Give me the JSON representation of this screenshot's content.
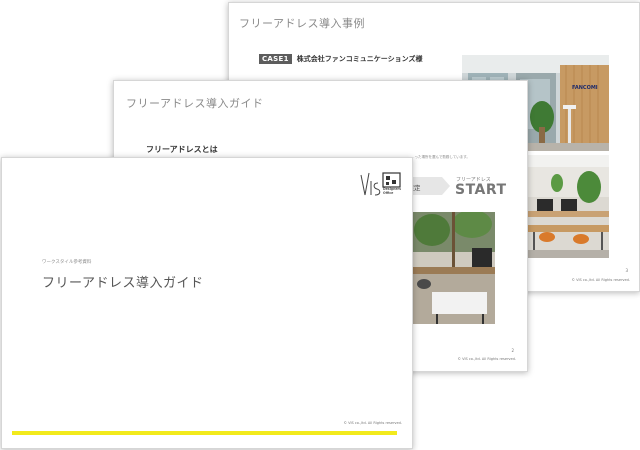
{
  "slides": {
    "case": {
      "title": "フリーアドレス導入事例",
      "case_tag": "CASE1",
      "company": "株式会社ファンコミュニケーションズ様",
      "sign_text": "FANCOMI",
      "page_number": "3",
      "footer": "© VIS co.,ltd. All Rights reserved."
    },
    "guide": {
      "title": "フリーアドレス導入ガイド",
      "section_heading": "フリーアドレスとは",
      "body_text": "…った場所を選んで勤務しています。",
      "step_label": "の策定",
      "start_small": "フリーアドレス",
      "start_big": "START",
      "page_number": "2",
      "footer": "© VIS co.,ltd. All Rights reserved."
    },
    "cover": {
      "subtitle": "ワークスタイル参考資料",
      "title": "フリーアドレス導入ガイド",
      "brand_line1": "Designers",
      "brand_line2": "Office",
      "footer": "© VIS co.,ltd. All Rights reserved."
    }
  },
  "colors": {
    "accent_yellow": "#f2ea1c",
    "case_tag_bg": "#5d5d5d",
    "title_gray": "#8a8a8a"
  }
}
